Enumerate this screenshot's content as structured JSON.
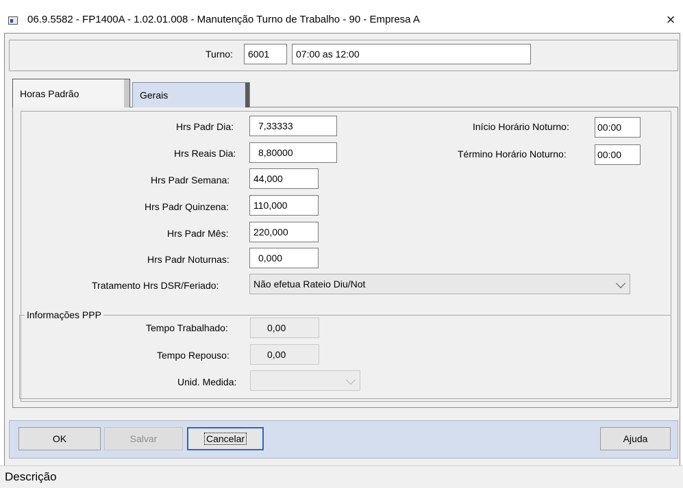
{
  "window": {
    "title": "06.9.5582 - FP1400A - 1.02.01.008 - Manutenção Turno de Trabalho - 90 - Empresa A",
    "close_glyph": "×"
  },
  "turno": {
    "label": "Turno:",
    "code": "6001",
    "description": "07:00 as 12:00"
  },
  "tabs": [
    {
      "label": "Horas Padrão",
      "active": true
    },
    {
      "label": "Gerais",
      "active": false
    }
  ],
  "horas": {
    "padr_dia": {
      "label": "Hrs Padr Dia:",
      "value": "7,33333"
    },
    "reais_dia": {
      "label": "Hrs Reais Dia:",
      "value": "8,80000"
    },
    "padr_semana": {
      "label": "Hrs Padr Semana:",
      "value": "44,000"
    },
    "padr_quinzena": {
      "label": "Hrs Padr Quinzena:",
      "value": "110,000"
    },
    "padr_mes": {
      "label": "Hrs Padr Mês:",
      "value": "220,000"
    },
    "padr_noturnas": {
      "label": "Hrs Padr Noturnas:",
      "value": "0,000"
    },
    "tratamento": {
      "label": "Tratamento Hrs DSR/Feriado:",
      "value": "Não efetua Rateio Diu/Not"
    },
    "inicio_noturno": {
      "label": "Início Horário Noturno:",
      "value": "00:00"
    },
    "termino_noturno": {
      "label": "Término Horário Noturno:",
      "value": "00:00"
    }
  },
  "ppp": {
    "legend": "Informações PPP",
    "tempo_trabalhado": {
      "label": "Tempo Trabalhado:",
      "value": "0,00"
    },
    "tempo_repouso": {
      "label": "Tempo Repouso:",
      "value": "0,00"
    },
    "unid_medida": {
      "label": "Unid. Medida:",
      "value": ""
    }
  },
  "buttons": {
    "ok": "OK",
    "salvar": "Salvar",
    "cancelar": "Cancelar",
    "ajuda": "Ajuda"
  },
  "status": {
    "text": "Descrição"
  }
}
